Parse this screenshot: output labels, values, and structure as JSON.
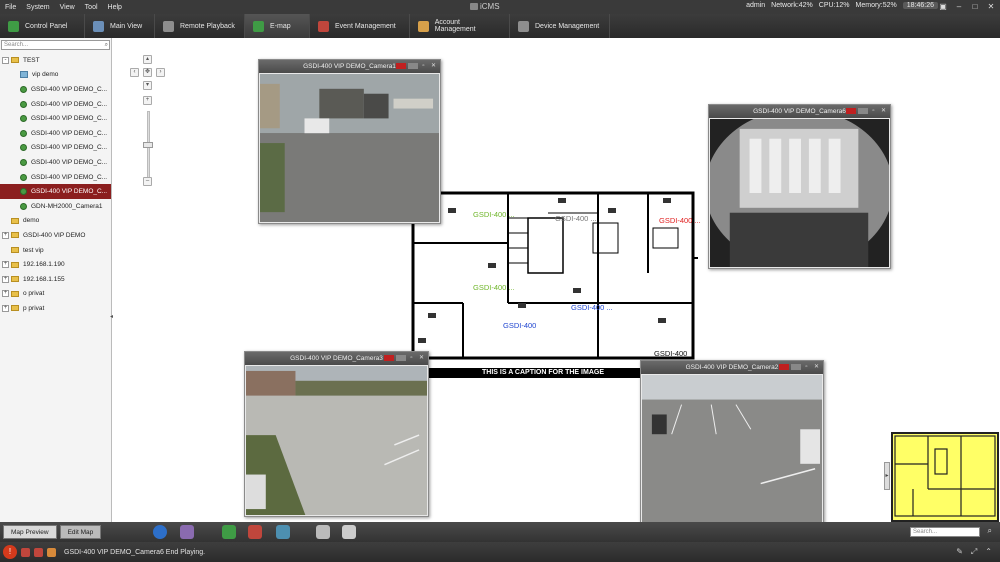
{
  "app": {
    "title": "iCMS",
    "user": "admin",
    "network": "Network:42%",
    "cpu": "CPU:12%",
    "memory": "Memory:52%",
    "clock": "18:46:26"
  },
  "menu": [
    "File",
    "System",
    "View",
    "Tool",
    "Help"
  ],
  "tabs": [
    {
      "label": "Control Panel",
      "icon_color": "#3f9b45"
    },
    {
      "label": "Main View",
      "icon_color": "#6b8fb8"
    },
    {
      "label": "Remote Playback",
      "icon_color": "#8e8e8e"
    },
    {
      "label": "E-map",
      "icon_color": "#3f9b45"
    },
    {
      "label": "Event Management",
      "icon_color": "#c0463c"
    },
    {
      "label": "Account Management",
      "icon_color": "#d7a04a"
    },
    {
      "label": "Device Management",
      "icon_color": "#8e8e8e"
    }
  ],
  "sidebar": {
    "search_placeholder": "Search...",
    "tree": [
      {
        "label": "TEST",
        "type": "folder",
        "expander": "-"
      },
      {
        "label": "vip demo",
        "type": "map",
        "expander": ""
      },
      {
        "label": "GSDI-400 VIP DEMO_C...",
        "type": "cam",
        "expander": ""
      },
      {
        "label": "GSDI-400 VIP DEMO_C...",
        "type": "cam",
        "expander": ""
      },
      {
        "label": "GSDI-400 VIP DEMO_C...",
        "type": "cam",
        "expander": ""
      },
      {
        "label": "GSDI-400 VIP DEMO_C...",
        "type": "cam",
        "expander": ""
      },
      {
        "label": "GSDI-400 VIP DEMO_C...",
        "type": "cam",
        "expander": ""
      },
      {
        "label": "GSDI-400 VIP DEMO_C...",
        "type": "cam",
        "expander": ""
      },
      {
        "label": "GSDI-400 VIP DEMO_C...",
        "type": "cam",
        "expander": ""
      },
      {
        "label": "GSDI-400 VIP DEMO_C...",
        "type": "cam",
        "expander": "",
        "selected": true
      },
      {
        "label": "GDN-MH2000_Camera1",
        "type": "cam",
        "expander": ""
      },
      {
        "label": "demo",
        "type": "folder",
        "expander": ""
      },
      {
        "label": "GSDI-400 VIP DEMO",
        "type": "folder",
        "expander": "+"
      },
      {
        "label": "test vip",
        "type": "folder",
        "expander": ""
      },
      {
        "label": "192.168.1.190",
        "type": "folder",
        "expander": "+"
      },
      {
        "label": "192.168.1.155",
        "type": "folder",
        "expander": "+"
      },
      {
        "label": "o privat",
        "type": "folder",
        "expander": "+"
      },
      {
        "label": "p privat",
        "type": "folder",
        "expander": "+"
      }
    ]
  },
  "camera_windows": {
    "cam1": "GSDI-400 VIP DEMO_Camera1",
    "cam6": "GSDI-400 VIP DEMO_Camera6",
    "cam3": "GSDI-400 VIP DEMO_Camera3",
    "cam2": "GSDI-400 VIP DEMO_Camera2"
  },
  "map_labels": {
    "g1": "GSDI-400",
    "g2": "GSDI-400 ...",
    "g3": "GSDI-400 ...",
    "g4": "GSDI-400 ...",
    "g5": "GSDI-400 ...",
    "g6": "GSDI-400 ...",
    "g7": "GSDI-400",
    "g8": "GSDI-400",
    "caption": "THIS IS A CAPTION FOR THE IMAGE"
  },
  "label_colors": {
    "green": "#6fb62a",
    "gray": "#777777",
    "red": "#e02020",
    "blue": "#2046d0",
    "black": "#111111"
  },
  "bottom": {
    "map_preview": "Map Preview",
    "edit_map": "Edit Map",
    "search_placeholder": "Search..."
  },
  "status": {
    "message": "GSDI-400 VIP DEMO_Camera6 End Playing."
  }
}
